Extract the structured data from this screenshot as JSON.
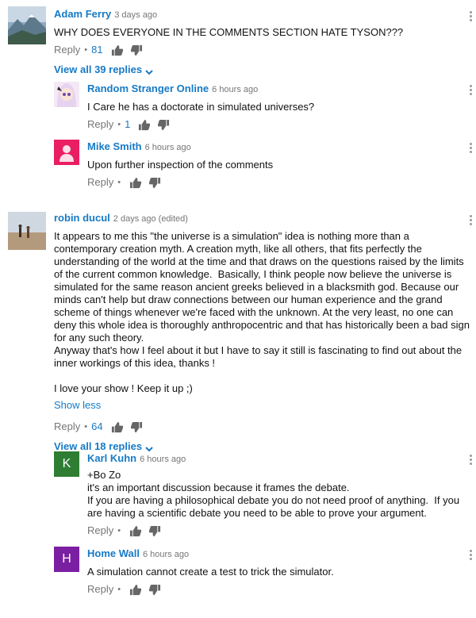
{
  "comments": [
    {
      "author": "Adam Ferry",
      "time": "3 days ago",
      "text": "WHY DOES EVERYONE IN THE COMMENTS SECTION HATE TYSON???",
      "reply_label": "Reply",
      "likes": "81",
      "view_replies": "View all 39 replies",
      "avatar_icon": "mountain-landscape-photo"
    },
    {
      "author": "Random Stranger Online",
      "time": "6 hours ago",
      "text": "I Care he has a doctorate in simulated universes?",
      "reply_label": "Reply",
      "likes": "1",
      "avatar_icon": "anime-character-photo"
    },
    {
      "author": "Mike Smith",
      "time": "6 hours ago",
      "text": "Upon further inspection of the comments",
      "reply_label": "Reply",
      "avatar_icon": "default-person-icon",
      "avatar_color": "#e91e63"
    },
    {
      "author": "robin ducul",
      "time": "2 days ago (edited)",
      "text": "It appears to me this \"the universe is a simulation\" idea is nothing more than a contemporary creation myth. A creation myth, like all others, that fits perfectly the understanding of the world at the time and that draws on the questions raised by the limits of the current common knowledge.  Basically, I think people now believe the universe is simulated for the same reason ancient greeks believed in a blacksmith god. Because our minds can't help but draw connections between our human experience and the grand scheme of things whenever we're faced with the unknown. At the very least, no one can deny this whole idea is thoroughly anthropocentric and that has historically been a bad sign for any such theory.\nAnyway that's how I feel about it but I have to say it still is fascinating to find out about the inner workings of this idea, thanks !\n\nI love your show ! Keep it up ;)",
      "show_less": "Show less",
      "reply_label": "Reply",
      "likes": "64",
      "view_replies": "View all 18 replies",
      "avatar_icon": "desert-people-photo"
    },
    {
      "author": "Karl Kuhn",
      "time": "6 hours ago",
      "text": "+Bo Zo\nit's an important discussion because it frames the debate.\nIf you are having a philosophical debate you do not need proof of anything.  If you are having a scientific debate you need to be able to prove your argument.",
      "reply_label": "Reply",
      "avatar_letter": "K",
      "avatar_color": "#2e7d32"
    },
    {
      "author": "Home Wall",
      "time": "6 hours ago",
      "text": "A simulation cannot create a test to trick the simulator.",
      "reply_label": "Reply",
      "avatar_letter": "H",
      "avatar_color": "#7b1fa2"
    }
  ]
}
